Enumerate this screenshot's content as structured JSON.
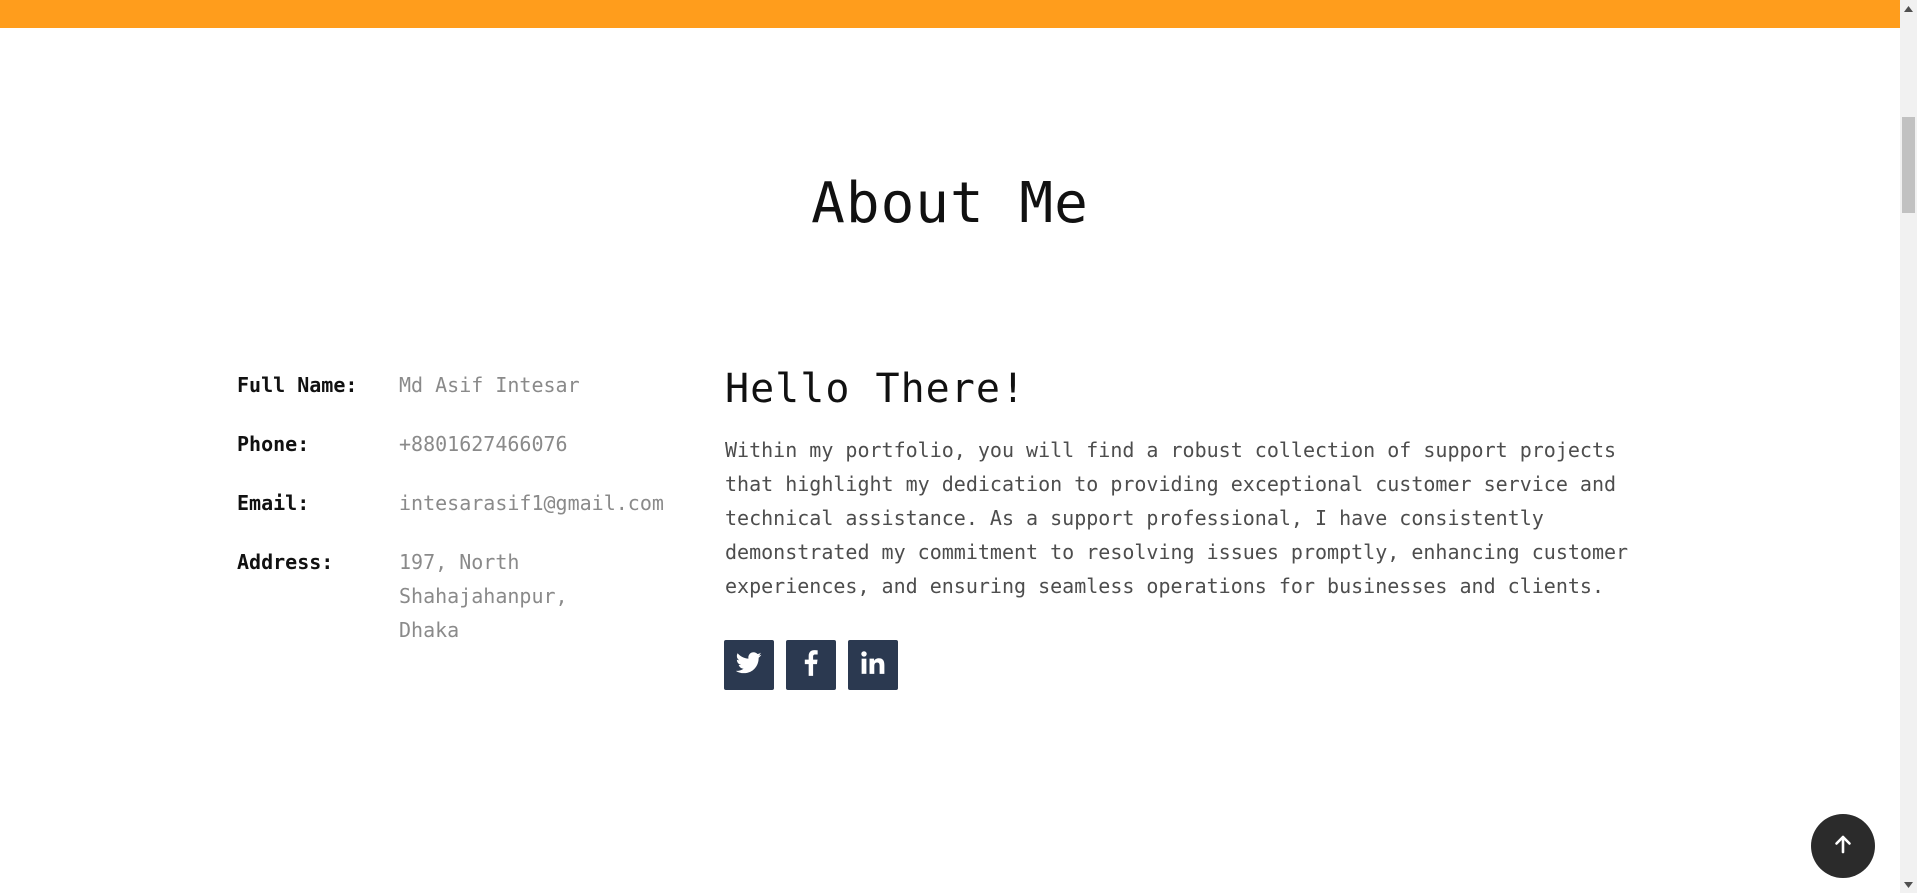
{
  "about": {
    "title": "About Me",
    "info": [
      {
        "label": "Full Name:",
        "value": "Md Asif Intesar"
      },
      {
        "label": "Phone:",
        "value": "+8801627466076"
      },
      {
        "label": "Email:",
        "value": "intesarasif1@gmail.com"
      },
      {
        "label": "Address:",
        "value": "197, North Shahajahanpur, Dhaka"
      }
    ],
    "greeting": "Hello There!",
    "bio": "Within my portfolio, you will find a robust collection of support projects that highlight my dedication to providing exceptional customer service and technical assistance. As a support professional, I have consistently demonstrated my commitment to resolving issues promptly, enhancing customer experiences, and ensuring seamless operations for businesses and clients.",
    "socials": [
      {
        "icon": "twitter-icon"
      },
      {
        "icon": "facebook-icon"
      },
      {
        "icon": "linkedin-icon"
      }
    ]
  },
  "back_to_top": {
    "icon": "arrow-up-icon"
  },
  "colors": {
    "accent": "#ff9d1c",
    "social_bg": "#2b3950",
    "back_to_top_bg": "#2b2b2b",
    "label_text": "#111111",
    "value_text": "#8a8a8a",
    "body_text": "#4d4d4d"
  }
}
